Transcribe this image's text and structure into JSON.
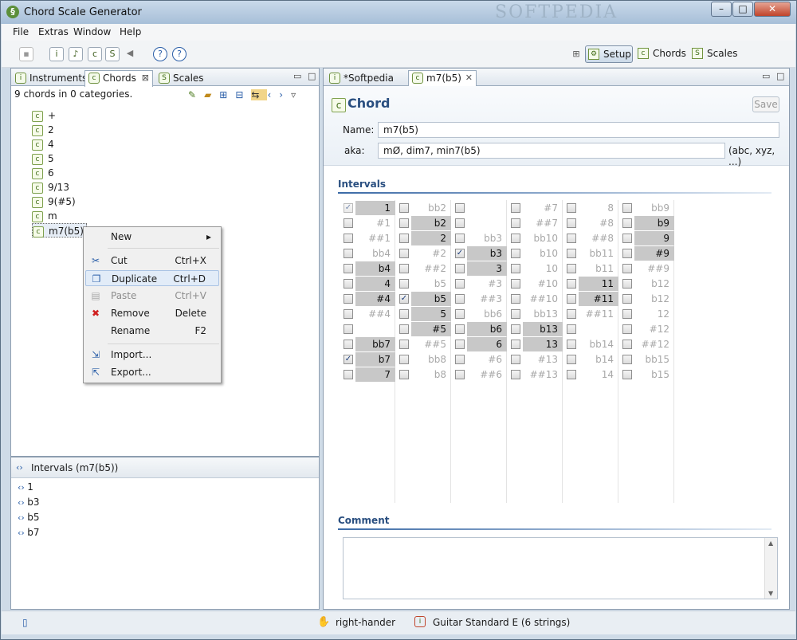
{
  "window": {
    "title": "Chord Scale Generator",
    "watermark": "SOFTPEDIA",
    "min": "–",
    "max": "□",
    "close": "✕"
  },
  "menu": [
    "File",
    "Extras",
    "Window",
    "Help"
  ],
  "perspectives": {
    "setup": "Setup",
    "chords": "Chords",
    "scales": "Scales"
  },
  "left_tabs": {
    "instruments": "Instruments",
    "chords": "Chords",
    "scales": "Scales"
  },
  "chords_panel": {
    "summary": "9 chords in 0 categories.",
    "items": [
      "+",
      "2",
      "4",
      "5",
      "6",
      "9/13",
      "9(#5)",
      "m",
      "m7(b5)"
    ]
  },
  "context_menu": {
    "new": "New",
    "cut": "Cut",
    "cut_sc": "Ctrl+X",
    "duplicate": "Duplicate",
    "duplicate_sc": "Ctrl+D",
    "paste": "Paste",
    "paste_sc": "Ctrl+V",
    "remove": "Remove",
    "remove_sc": "Delete",
    "rename": "Rename",
    "rename_sc": "F2",
    "import": "Import...",
    "export": "Export..."
  },
  "intervals_panel": {
    "title": "Intervals (m7(b5))",
    "items": [
      "1",
      "b3",
      "b5",
      "b7"
    ]
  },
  "editor_tabs": {
    "softpedia": "*Softpedia",
    "chord": "m7(b5)"
  },
  "editor": {
    "heading": "Chord",
    "save": "Save",
    "name_label": "Name:",
    "name_value": "m7(b5)",
    "aka_label": "aka:",
    "aka_value": "mØ, dim7, min7(b5)",
    "aka_hint": "(abc, xyz, ...)",
    "intervals_title": "Intervals",
    "comment_title": "Comment"
  },
  "interval_grid": [
    [
      {
        "t": "1",
        "s": "on",
        "c": true,
        "d": true
      },
      {
        "t": "#1",
        "s": "off"
      },
      {
        "t": "##1",
        "s": "off"
      },
      {
        "t": "bb4",
        "s": "off"
      },
      {
        "t": "b4",
        "s": "on"
      },
      {
        "t": "4",
        "s": "on"
      },
      {
        "t": "#4",
        "s": "on"
      },
      {
        "t": "##4",
        "s": "off"
      },
      {
        "t": "",
        "s": "none"
      },
      {
        "t": "bb7",
        "s": "on"
      },
      {
        "t": "b7",
        "s": "on",
        "c": true
      },
      {
        "t": "7",
        "s": "on"
      }
    ],
    [
      {
        "t": "bb2",
        "s": "off"
      },
      {
        "t": "b2",
        "s": "on"
      },
      {
        "t": "2",
        "s": "on"
      },
      {
        "t": "#2",
        "s": "off"
      },
      {
        "t": "##2",
        "s": "off"
      },
      {
        "t": "b5",
        "s": "off"
      },
      {
        "t": "b5",
        "s": "on",
        "c": true
      },
      {
        "t": "5",
        "s": "on"
      },
      {
        "t": "#5",
        "s": "on"
      },
      {
        "t": "##5",
        "s": "off"
      },
      {
        "t": "bb8",
        "s": "off"
      },
      {
        "t": "b8",
        "s": "off"
      }
    ],
    [
      {
        "t": "",
        "s": "none"
      },
      {
        "t": "",
        "s": "none"
      },
      {
        "t": "bb3",
        "s": "off"
      },
      {
        "t": "b3",
        "s": "on",
        "c": true
      },
      {
        "t": "3",
        "s": "on"
      },
      {
        "t": "#3",
        "s": "off"
      },
      {
        "t": "##3",
        "s": "off"
      },
      {
        "t": "bb6",
        "s": "off"
      },
      {
        "t": "b6",
        "s": "on"
      },
      {
        "t": "6",
        "s": "on"
      },
      {
        "t": "#6",
        "s": "off"
      },
      {
        "t": "##6",
        "s": "off"
      }
    ],
    [
      {
        "t": "#7",
        "s": "off"
      },
      {
        "t": "##7",
        "s": "off"
      },
      {
        "t": "bb10",
        "s": "off"
      },
      {
        "t": "b10",
        "s": "off"
      },
      {
        "t": "10",
        "s": "off"
      },
      {
        "t": "#10",
        "s": "off"
      },
      {
        "t": "##10",
        "s": "off"
      },
      {
        "t": "bb13",
        "s": "off"
      },
      {
        "t": "b13",
        "s": "on"
      },
      {
        "t": "13",
        "s": "on"
      },
      {
        "t": "#13",
        "s": "off"
      },
      {
        "t": "##13",
        "s": "off"
      }
    ],
    [
      {
        "t": "8",
        "s": "off"
      },
      {
        "t": "#8",
        "s": "off"
      },
      {
        "t": "##8",
        "s": "off"
      },
      {
        "t": "bb11",
        "s": "off"
      },
      {
        "t": "b11",
        "s": "off"
      },
      {
        "t": "11",
        "s": "on"
      },
      {
        "t": "#11",
        "s": "on"
      },
      {
        "t": "##11",
        "s": "off"
      },
      {
        "t": "",
        "s": "none"
      },
      {
        "t": "bb14",
        "s": "off"
      },
      {
        "t": "b14",
        "s": "off"
      },
      {
        "t": "14",
        "s": "off"
      }
    ],
    [
      {
        "t": "bb9",
        "s": "off"
      },
      {
        "t": "b9",
        "s": "on"
      },
      {
        "t": "9",
        "s": "on"
      },
      {
        "t": "#9",
        "s": "on"
      },
      {
        "t": "##9",
        "s": "off"
      },
      {
        "t": "b12",
        "s": "off"
      },
      {
        "t": "b12",
        "s": "off"
      },
      {
        "t": "12",
        "s": "off"
      },
      {
        "t": "#12",
        "s": "off"
      },
      {
        "t": "##12",
        "s": "off"
      },
      {
        "t": "bb15",
        "s": "off"
      },
      {
        "t": "b15",
        "s": "off"
      }
    ]
  ],
  "status": {
    "hand": "right-hander",
    "instrument": "Guitar Standard E (6 strings)"
  }
}
